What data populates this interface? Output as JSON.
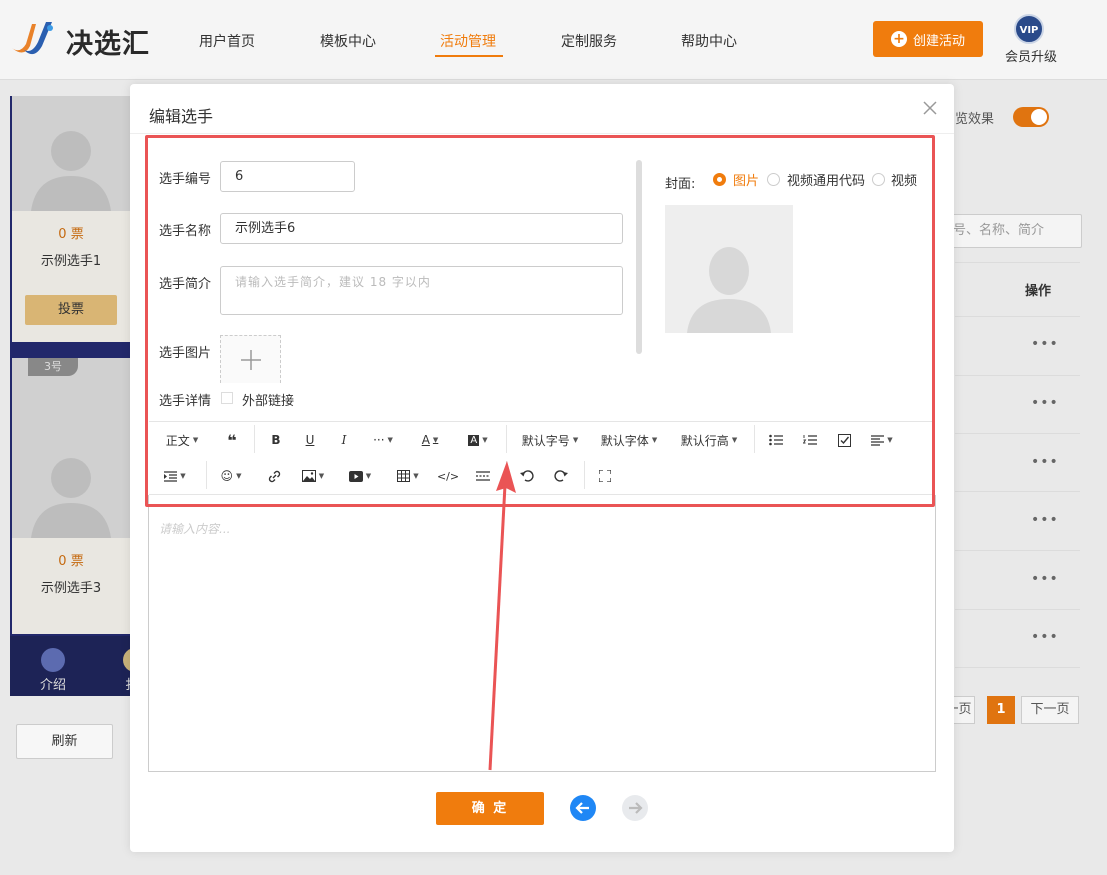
{
  "header": {
    "logo_text": "决选汇",
    "nav": [
      "用户首页",
      "模板中心",
      "活动管理",
      "定制服务",
      "帮助中心"
    ],
    "active_nav": "活动管理",
    "create_button": "创建活动",
    "vip_badge": "VIP",
    "vip_label": "会员升级"
  },
  "background": {
    "cards": [
      {
        "votes": "0 票",
        "name": "示例选手1",
        "vote_button": "投票"
      },
      {
        "votes": "0 票",
        "name": "示例选手3"
      }
    ],
    "badge": "3号",
    "bottom_nav_intro": "介绍",
    "bottom_nav_other": "扌",
    "refresh_button": "刷新",
    "preview_label": "览效果",
    "search_placeholder": "号、名称、简介",
    "ops_header": "操作",
    "row_dots": "•••",
    "pagination": {
      "prev": "一页",
      "current": "1",
      "next": "下一页"
    }
  },
  "modal": {
    "title": "编辑选手",
    "fields": {
      "number_label": "选手编号",
      "number_value": "6",
      "name_label": "选手名称",
      "name_value": "示例选手6",
      "intro_label": "选手简介",
      "intro_placeholder": "请输入选手简介，建议 18 字以内",
      "image_label": "选手图片",
      "detail_label": "选手详情",
      "external_link_label": "外部链接"
    },
    "cover": {
      "label": "封面:",
      "options": [
        "图片",
        "视频通用代码",
        "视频"
      ],
      "selected": "图片"
    },
    "toolbar": {
      "paragraph": "正文",
      "font_size": "默认字号",
      "font_family": "默认字体",
      "line_height": "默认行高"
    },
    "editor_placeholder": "请输入内容...",
    "confirm_button": "确 定"
  },
  "colors": {
    "accent": "#f07c0d",
    "highlight": "#ea5455",
    "blue": "#1f87f5"
  }
}
